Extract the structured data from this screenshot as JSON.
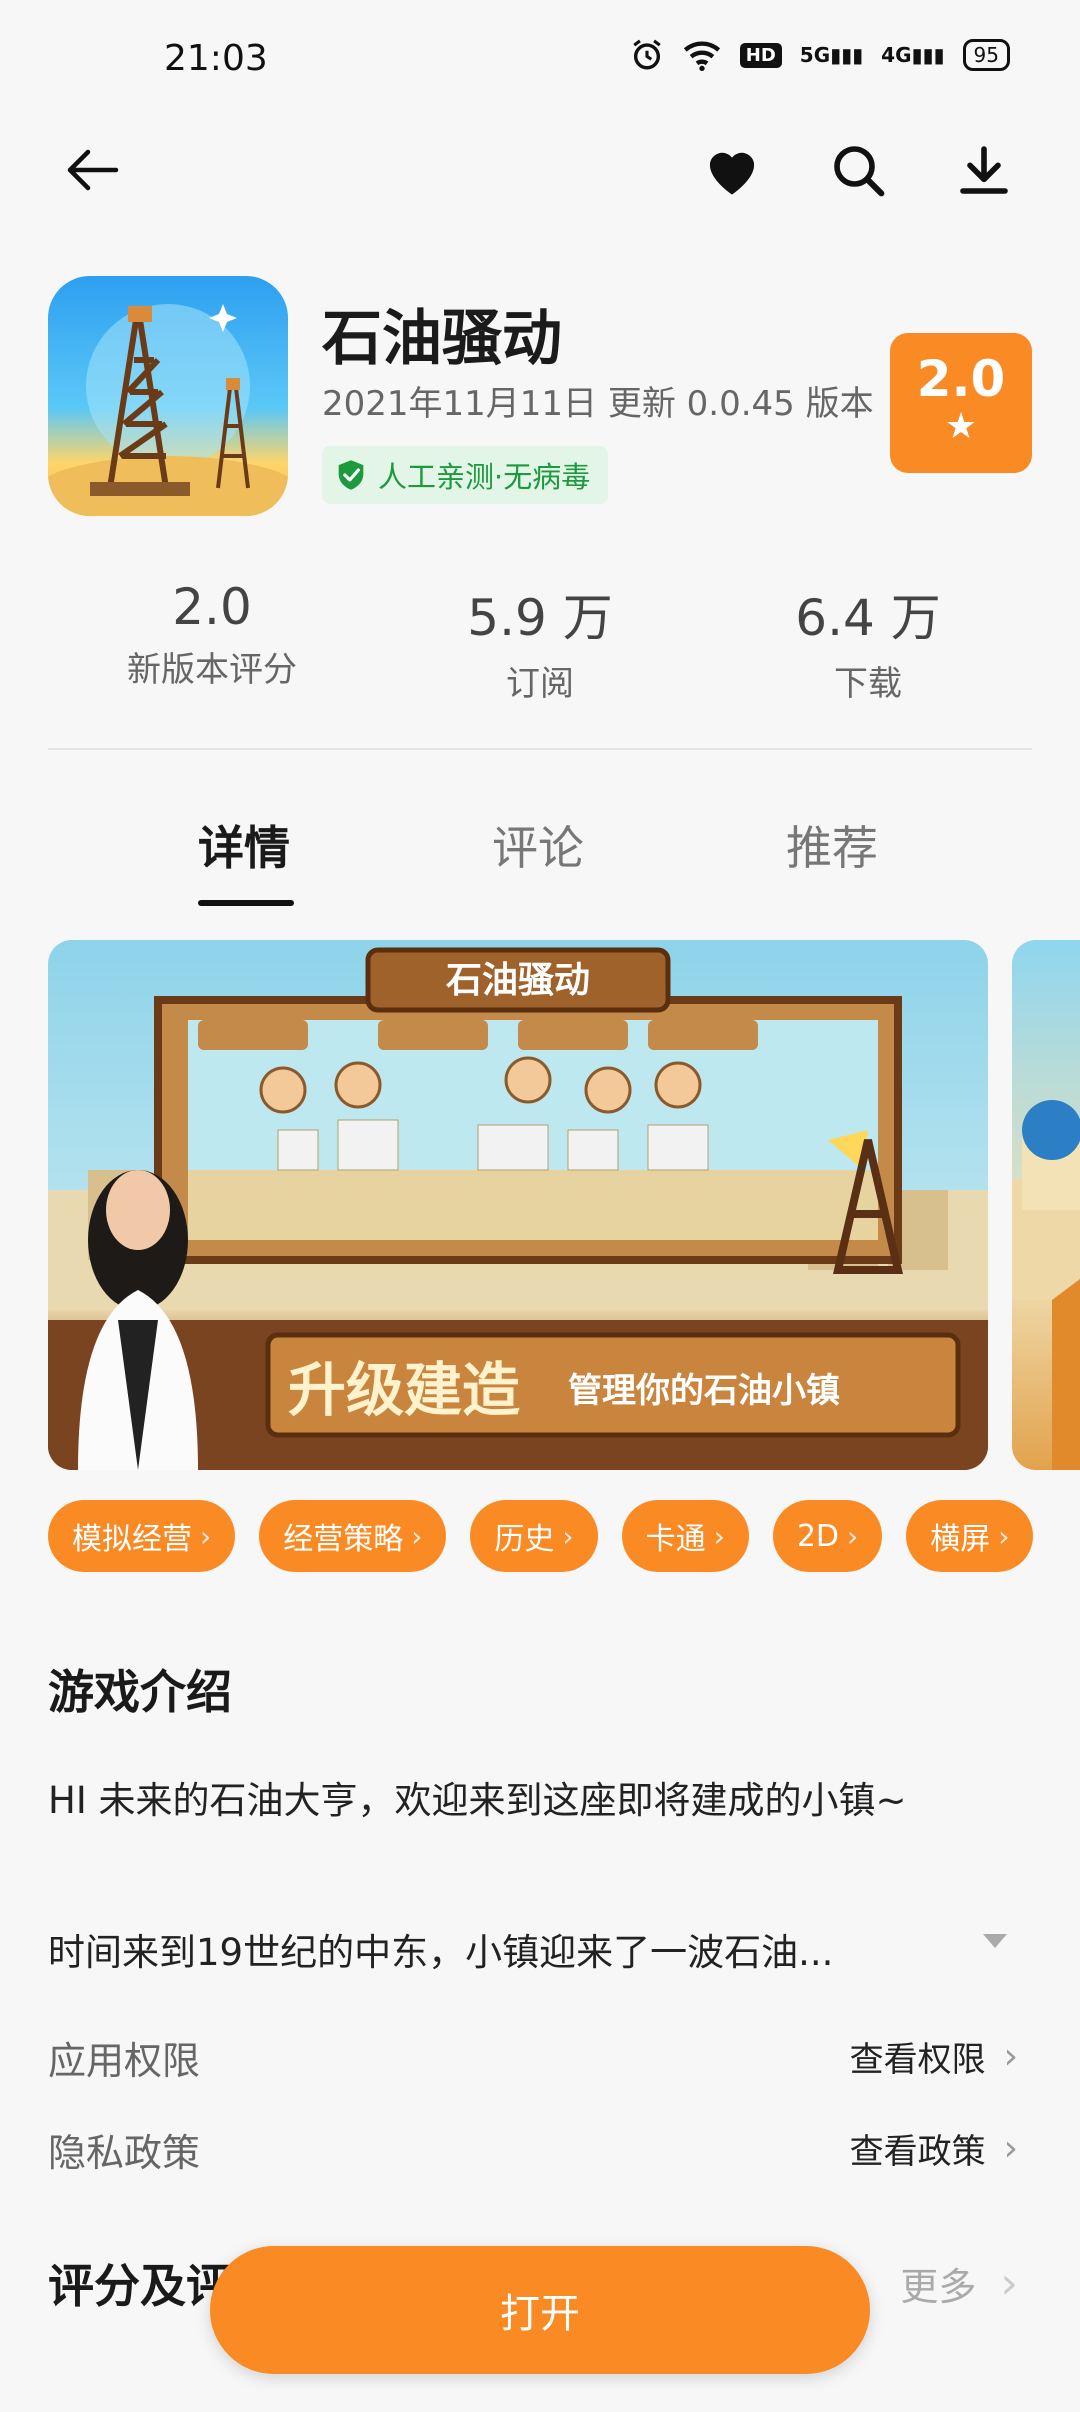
{
  "status_bar": {
    "time": "21:03",
    "signal_5g": "5G",
    "signal_4g": "4G",
    "battery": "95"
  },
  "app": {
    "name": "石油骚动",
    "update_info": "2021年11月11日 更新 0.0.45 版本",
    "safety_badge": "人工亲测·无病毒",
    "rating": "2.0"
  },
  "stats": [
    {
      "value": "2.0",
      "label": "新版本评分"
    },
    {
      "value": "5.9 万",
      "label": "订阅"
    },
    {
      "value": "6.4 万",
      "label": "下载"
    }
  ],
  "tabs": [
    {
      "label": "详情",
      "active": true
    },
    {
      "label": "评论",
      "active": false
    },
    {
      "label": "推荐",
      "active": false
    }
  ],
  "screenshot": {
    "banner_title": "石油骚动",
    "slogan_big": "升级建造",
    "slogan_small": "管理你的石油小镇"
  },
  "tags": [
    "模拟经营",
    "经营策略",
    "历史",
    "卡通",
    "2D",
    "横屏"
  ],
  "intro": {
    "title": "游戏介绍",
    "line1": "HI 未来的石油大亨，欢迎来到这座即将建成的小镇~",
    "line2": "时间来到19世纪的中东，小镇迎来了一波石油..."
  },
  "permissions": {
    "label": "应用权限",
    "action": "查看权限"
  },
  "privacy": {
    "label": "隐私政策",
    "action": "查看政策"
  },
  "reviews": {
    "title": "评分及评论",
    "more": "更多"
  },
  "open_button": "打开",
  "colors": {
    "accent": "#f98a24",
    "safe_green": "#1c9a3d"
  }
}
